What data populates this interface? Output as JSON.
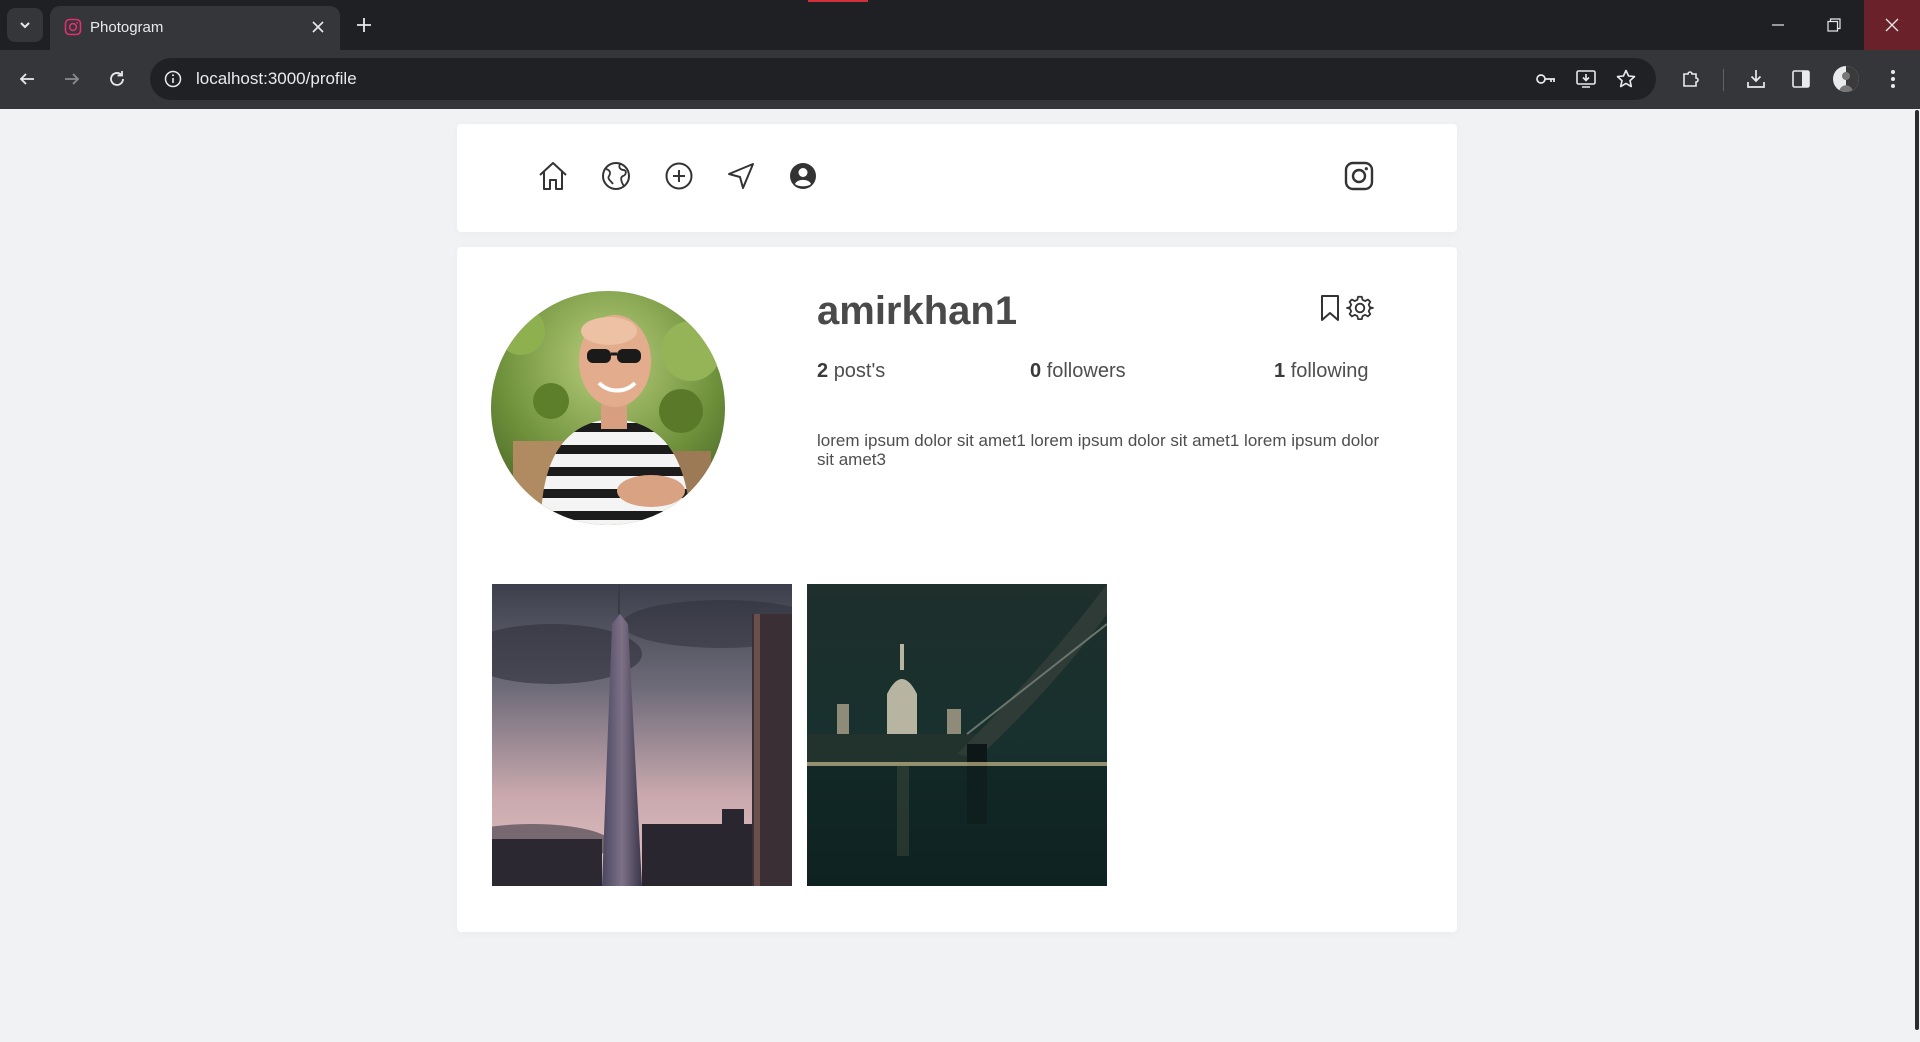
{
  "browser": {
    "tab_title": "Photogram",
    "url": "localhost:3000/profile"
  },
  "nav": {
    "icons": [
      "home-icon",
      "globe-icon",
      "add-circle-icon",
      "send-icon",
      "user-circle-icon"
    ],
    "brand_icon": "instagram-icon"
  },
  "profile": {
    "username": "amirkhan1",
    "posts_count": "2",
    "posts_label": "post's",
    "followers_count": "0",
    "followers_label": "followers",
    "following_count": "1",
    "following_label": "following",
    "bio": "lorem ipsum dolor sit amet1 lorem ipsum dolor sit amet1 lorem ipsum dolor sit amet3"
  },
  "posts": [
    {
      "description": "skyscraper-photo"
    },
    {
      "description": "night-cathedral-bridge-photo"
    }
  ],
  "colors": {
    "page_bg": "#f1f2f4",
    "card_bg": "#ffffff",
    "text": "#4a4a4a",
    "browser_frame": "#1f2023",
    "browser_toolbar": "#35363a"
  }
}
